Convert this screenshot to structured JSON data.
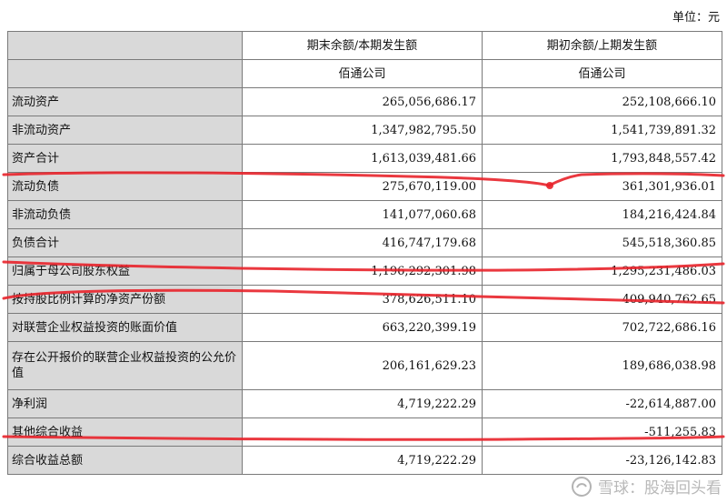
{
  "unit_label": "单位：元",
  "header": {
    "col1": "期末余额/本期发生额",
    "col2": "期初余额/上期发生额",
    "sub1": "佰通公司",
    "sub2": "佰通公司"
  },
  "rows": [
    {
      "label": "流动资产",
      "v1": "265,056,686.17",
      "v2": "252,108,666.10"
    },
    {
      "label": "非流动资产",
      "v1": "1,347,982,795.50",
      "v2": "1,541,739,891.32"
    },
    {
      "label": "资产合计",
      "v1": "1,613,039,481.66",
      "v2": "1,793,848,557.42"
    },
    {
      "label": "流动负债",
      "v1": "275,670,119.00",
      "v2": "361,301,936.01"
    },
    {
      "label": "非流动负债",
      "v1": "141,077,060.68",
      "v2": "184,216,424.84"
    },
    {
      "label": "负债合计",
      "v1": "416,747,179.68",
      "v2": "545,518,360.85"
    },
    {
      "label": "归属于母公司股东权益",
      "v1": "1,196,292,301.98",
      "v2": "1,295,231,486.03"
    },
    {
      "label": "按持股比例计算的净资产份额",
      "v1": "378,626,511.10",
      "v2": "409,940,762.65"
    },
    {
      "label": "对联营企业权益投资的账面价值",
      "v1": "663,220,399.19",
      "v2": "702,722,686.16"
    },
    {
      "label": "存在公开报价的联营企业权益投资的公允价值",
      "v1": "206,161,629.23",
      "v2": "189,686,038.98"
    },
    {
      "label": "净利润",
      "v1": "4,719,222.29",
      "v2": "-22,614,887.00"
    },
    {
      "label": "其他综合收益",
      "v1": "",
      "v2": "-511,255.83"
    },
    {
      "label": "综合收益总额",
      "v1": "4,719,222.29",
      "v2": "-23,126,142.83"
    }
  ],
  "watermark": "雪球：股海回头看",
  "colors": {
    "label_bg": "#d9d9d9",
    "border": "#7a7a7a",
    "marker": "#e8222a"
  }
}
